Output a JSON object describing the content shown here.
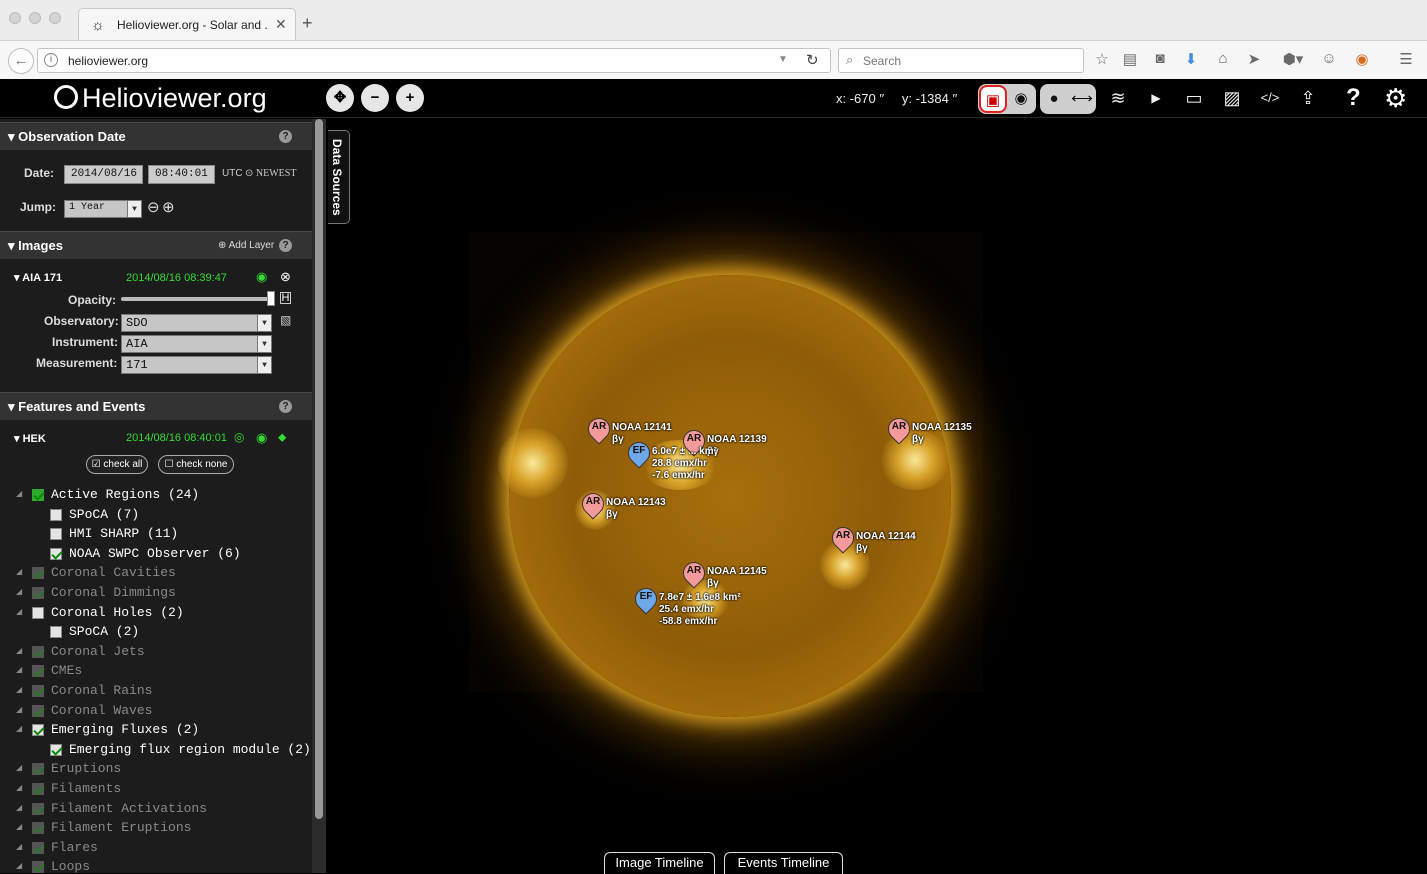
{
  "browser": {
    "tab_title": "Helioviewer.org - Solar and ...",
    "url": "helioviewer.org",
    "search_placeholder": "Search"
  },
  "app": {
    "logo": "Helioviewer.org",
    "coords_x": "x: -670 ′′",
    "coords_y": "y: -1384 ′′"
  },
  "observation": {
    "heading": "Observation Date",
    "date_label": "Date:",
    "date_value": "2014/08/16",
    "time_value": "08:40:01",
    "utc": "UTC",
    "newest": "NEWEST",
    "jump_label": "Jump:",
    "jump_value": "1 Year"
  },
  "images": {
    "heading": "Images",
    "add_layer": "Add Layer",
    "layer_name": "AIA 171",
    "layer_time": "2014/08/16 08:39:47",
    "opacity_label": "Opacity:",
    "opacity": 1.0,
    "observatory_label": "Observatory:",
    "observatory": "SDO",
    "instrument_label": "Instrument:",
    "instrument": "AIA",
    "measurement_label": "Measurement:",
    "measurement": "171"
  },
  "features": {
    "heading": "Features and Events",
    "source": "HEK",
    "source_time": "2014/08/16 08:40:01",
    "check_all": "check all",
    "check_none": "check none",
    "events": [
      {
        "label": "Active Regions (24)",
        "state": "on",
        "check": "full"
      },
      {
        "label": "SPoCA (7)",
        "state": "on",
        "check": "empty",
        "child": true
      },
      {
        "label": "HMI SHARP (11)",
        "state": "on",
        "check": "empty",
        "child": true
      },
      {
        "label": "NOAA SWPC Observer (6)",
        "state": "on",
        "check": "checked",
        "child": true
      },
      {
        "label": "Coronal Cavities",
        "state": "off",
        "check": "dim"
      },
      {
        "label": "Coronal Dimmings",
        "state": "off",
        "check": "dim"
      },
      {
        "label": "Coronal Holes (2)",
        "state": "on",
        "check": "empty"
      },
      {
        "label": "SPoCA (2)",
        "state": "on",
        "check": "empty",
        "child": true
      },
      {
        "label": "Coronal Jets",
        "state": "off",
        "check": "dim"
      },
      {
        "label": "CMEs",
        "state": "off",
        "check": "dim"
      },
      {
        "label": "Coronal Rains",
        "state": "off",
        "check": "dim"
      },
      {
        "label": "Coronal Waves",
        "state": "off",
        "check": "dim"
      },
      {
        "label": "Emerging Fluxes (2)",
        "state": "on",
        "check": "checked"
      },
      {
        "label": "Emerging flux region module (2)",
        "state": "on",
        "check": "checked",
        "child": true
      },
      {
        "label": "Eruptions",
        "state": "off",
        "check": "dim"
      },
      {
        "label": "Filaments",
        "state": "off",
        "check": "dim"
      },
      {
        "label": "Filament Activations",
        "state": "off",
        "check": "dim"
      },
      {
        "label": "Filament Eruptions",
        "state": "off",
        "check": "dim"
      },
      {
        "label": "Flares",
        "state": "off",
        "check": "dim"
      },
      {
        "label": "Loops",
        "state": "off",
        "check": "dim"
      }
    ]
  },
  "viewport": {
    "data_sources": "Data Sources",
    "image_timeline": "Image Timeline",
    "events_timeline": "Events Timeline",
    "markers": [
      {
        "code": "AR",
        "type": "ar",
        "lines": [
          "NOAA 12141",
          "βγ"
        ]
      },
      {
        "code": "AR",
        "type": "ar",
        "lines": [
          "NOAA 12139",
          "βγ"
        ]
      },
      {
        "code": "EF",
        "type": "ef",
        "lines": [
          "6.0e7 ± ... km²",
          "28.8 emx/hr",
          "-7.6 emx/hr"
        ]
      },
      {
        "code": "AR",
        "type": "ar",
        "lines": [
          "NOAA 12135",
          "βγ"
        ]
      },
      {
        "code": "AR",
        "type": "ar",
        "lines": [
          "NOAA 12143",
          "βγ"
        ]
      },
      {
        "code": "AR",
        "type": "ar",
        "lines": [
          "NOAA 12144",
          "βγ"
        ]
      },
      {
        "code": "AR",
        "type": "ar",
        "lines": [
          "NOAA 12145",
          "βγ"
        ]
      },
      {
        "code": "EF",
        "type": "ef",
        "lines": [
          "7.8e7 ± 1.6e8 km²",
          "25.4 emx/hr",
          "-58.8 emx/hr"
        ]
      }
    ]
  }
}
